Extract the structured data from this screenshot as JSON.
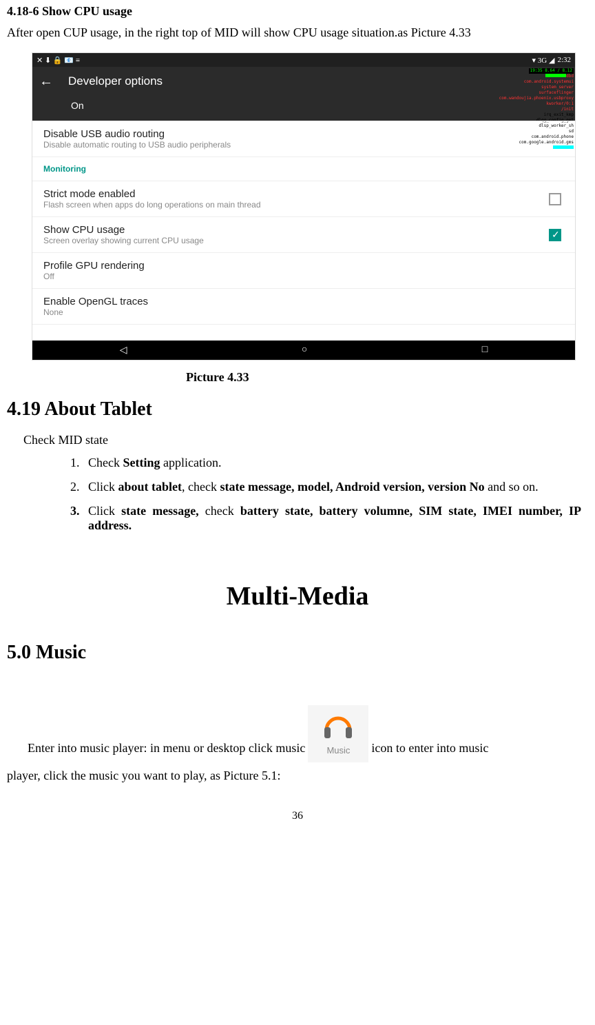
{
  "section1": {
    "numbered_title": "4.18-6 Show CPU usage",
    "intro": "After open CUP usage, in the right top of MID will show CPU usage situation.as Picture 4.33"
  },
  "screenshot": {
    "status_bar": {
      "icons_left": "✕ ⬇ 🔒 📧 ≡",
      "signal": "▾ 3G ◢",
      "time": "2:32"
    },
    "title_bar": {
      "back": "←",
      "title": "Developer options"
    },
    "on_row": "On",
    "cpu_overlay": {
      "line1": "19:35 8.64 / 8.12",
      "line2": "dbd",
      "line3": "com.android.systemui",
      "line4": "system_server",
      "line5": "surfaceflinger",
      "line6": "com.wandoujia.phoenix.usbproxy",
      "line7": "kworker/0:1",
      "line8": "/init",
      "line9a": "irq_exit_kmp",
      "line9b": "dlqg_config_get",
      "line9c": "dlsp_worker_sh",
      "line9d": "sd",
      "line9e": "com.android.phone",
      "line9f": "com.google.android.gms"
    },
    "items": [
      {
        "title": "Disable USB audio routing",
        "sub": "Disable automatic routing to USB audio peripherals",
        "checkbox": false,
        "no_box": true
      },
      {
        "title": "Monitoring",
        "sub": "",
        "category": true
      },
      {
        "title": "Strict mode enabled",
        "sub": "Flash screen when apps do long operations on main thread",
        "checkbox": false
      },
      {
        "title": "Show CPU usage",
        "sub": "Screen overlay showing current CPU usage",
        "checkbox": true
      },
      {
        "title": "Profile GPU rendering",
        "sub": "Off"
      },
      {
        "title": "Enable OpenGL traces",
        "sub": "None"
      }
    ],
    "nav": {
      "back": "◁",
      "home": "○",
      "recent": "□"
    }
  },
  "caption1": "Picture 4.33",
  "section2": {
    "title": "4.19 About Tablet",
    "p": "Check MID state",
    "li1_a": "Check ",
    "li1_b": "Setting",
    "li1_c": " application.",
    "li2_a": "Click ",
    "li2_b": "about tablet",
    "li2_c": ", check ",
    "li2_d": "state message, model, Android version, version No",
    "li2_e": " and so on.",
    "li3_a": "Click ",
    "li3_b": "state message, ",
    "li3_c": "check ",
    "li3_d": "battery state, battery volumne, SIM state, IMEI number, IP address."
  },
  "chapter_title": "Multi-Media",
  "section3": {
    "title": "5.0 Music",
    "p_a": "Enter into music player: in menu or desktop click music",
    "music_label": "Music",
    "p_b": "icon to enter into music",
    "p_c": "player, click the music you want to play, as Picture 5.1:"
  },
  "page_number": "36"
}
